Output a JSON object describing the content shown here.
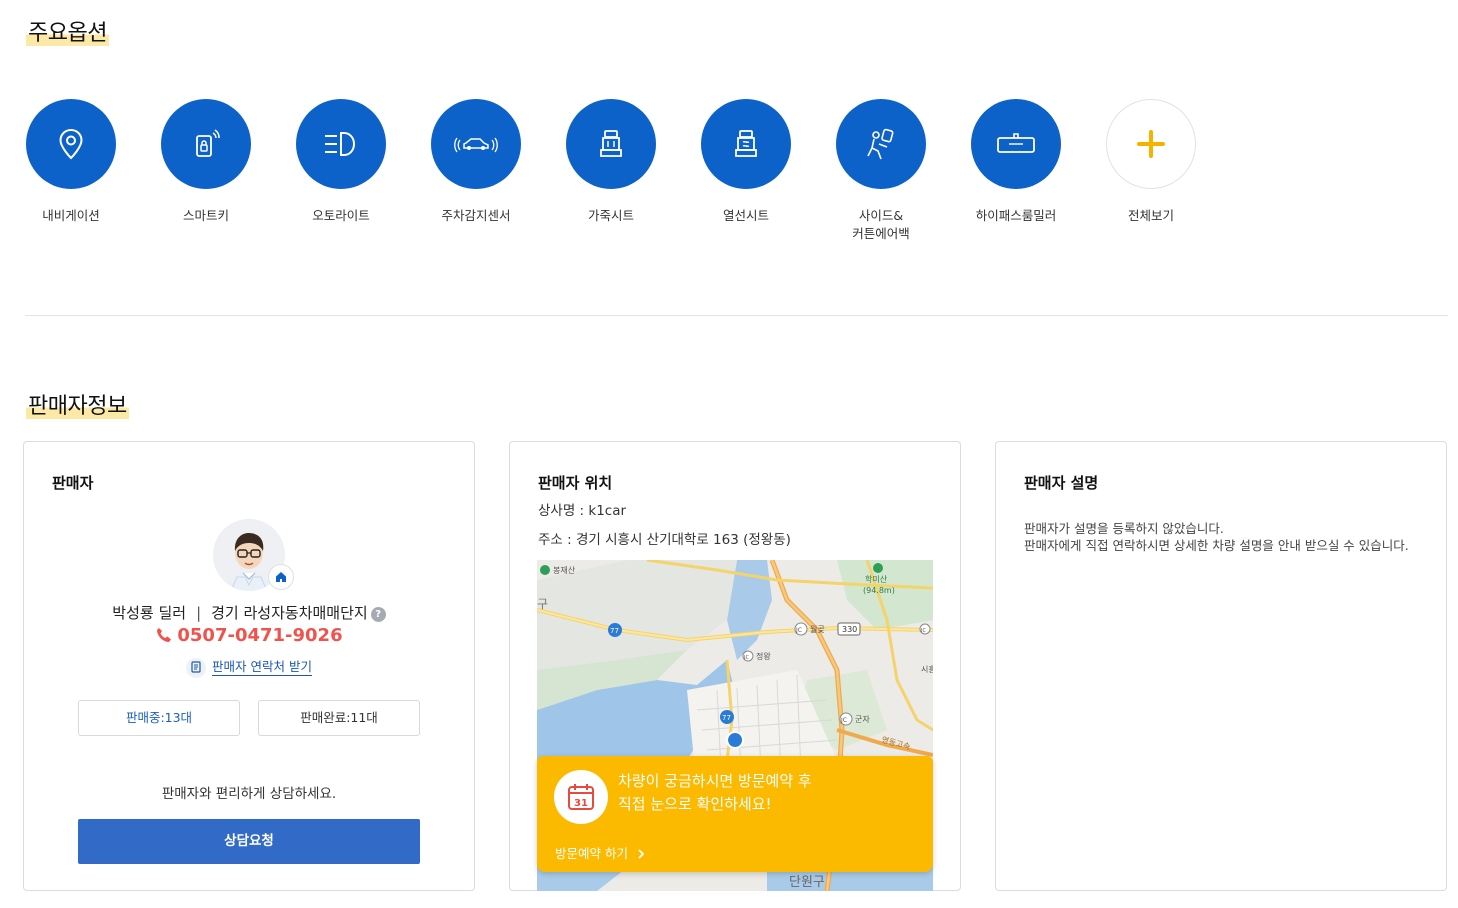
{
  "sections": {
    "options_title": "주요옵션",
    "seller_title": "판매자정보"
  },
  "options": [
    {
      "label": "내비게이션",
      "icon": "navigation-pin-icon"
    },
    {
      "label": "스마트키",
      "icon": "smart-key-icon"
    },
    {
      "label": "오토라이트",
      "icon": "auto-light-icon"
    },
    {
      "label": "주차감지센서",
      "icon": "parking-sensor-icon"
    },
    {
      "label": "가죽시트",
      "icon": "leather-seat-icon"
    },
    {
      "label": "열선시트",
      "icon": "heated-seat-icon"
    },
    {
      "label": "사이드&\n커튼에어백",
      "icon": "airbag-icon"
    },
    {
      "label": "하이패스룸밀러",
      "icon": "hipass-mirror-icon"
    },
    {
      "label": "전체보기",
      "icon": "plus-icon"
    }
  ],
  "seller_card": {
    "title": "판매자",
    "name": "박성룡 딜러",
    "separator": "|",
    "complex": "경기 라성자동차매매단지",
    "help_mark": "?",
    "phone": "0507-0471-9026",
    "contact_link": "판매자 연락처 받기",
    "selling": "판매중:13대",
    "sold": "판매완료:11대",
    "consult_text": "판매자와 편리하게 상담하세요.",
    "consult_button": "상담요청"
  },
  "location_card": {
    "title": "판매자 위치",
    "dealer": "상사명 : k1car",
    "address": "주소 : 경기 시흥시 산기대학로 163 (정왕동)",
    "map_labels": {
      "bongjaesan": "봉재산",
      "gu": "구",
      "hakmisan": "학미산",
      "hakmisan_height": "(94.8m)",
      "wolgot": "월곶",
      "road330": "330",
      "jeongwang": "정왕",
      "road77a": "77",
      "road77b": "77",
      "gunja": "군자",
      "expressway": "영동고속",
      "ic": "IC",
      "si": "시흥",
      "danwongu": "단원구"
    },
    "visit_day": "31",
    "visit_text_line1": "차량이 궁금하시면 방문예약 후",
    "visit_text_line2": "직접 눈으로 확인하세요!",
    "visit_link": "방문예약 하기"
  },
  "desc_card": {
    "title": "판매자 설명",
    "line1": "판매자가 설명을 등록하지 않았습니다.",
    "line2": "판매자에게 직접 연락하시면 상세한 차량 설명을 안내 받으실 수 있습니다."
  },
  "colors": {
    "primary_blue": "#0d62c9",
    "button_blue": "#316ac7",
    "phone_red": "#f0534d",
    "visit_yellow": "#fbba00",
    "highlight": "#fde9a6"
  }
}
